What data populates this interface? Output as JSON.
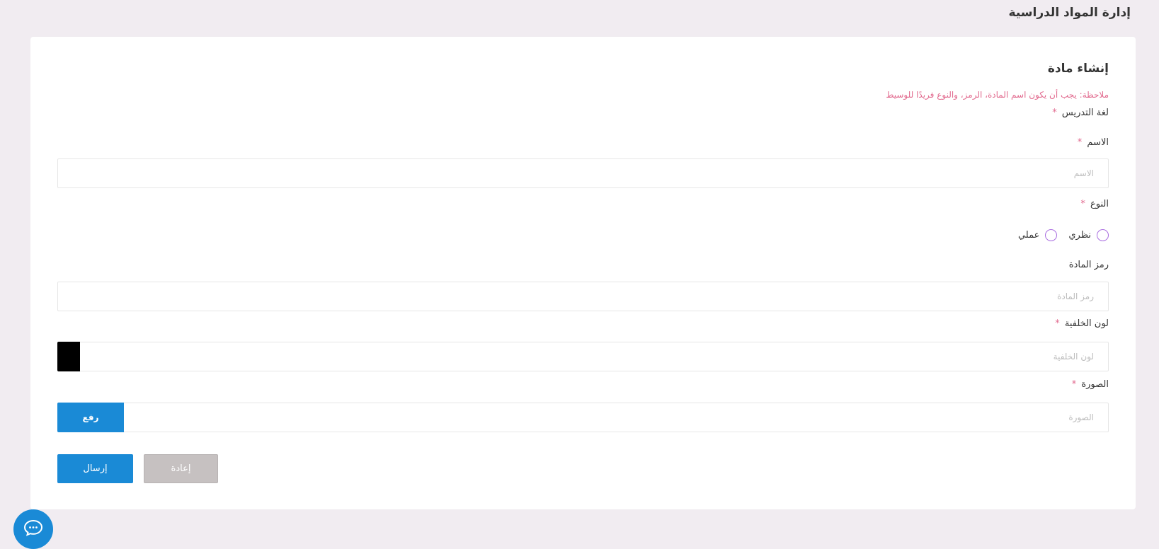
{
  "page": {
    "title": "إدارة المواد الدراسية"
  },
  "form": {
    "title": "إنشاء مادة",
    "note": "ملاحظة: يجب أن يكون اسم المادة، الرمز، والنوع فريدًا للوسيط",
    "required_mark": "*",
    "language": {
      "label": "لغة التدريس"
    },
    "name": {
      "label": "الاسم",
      "placeholder": "الاسم",
      "value": ""
    },
    "type": {
      "label": "النوع",
      "options": [
        "نظري",
        "عملي"
      ]
    },
    "code": {
      "label": "رمز المادة",
      "placeholder": "رمز المادة",
      "value": ""
    },
    "background_color": {
      "label": "لون الخلفية",
      "placeholder": "لون الخلفية",
      "value": "",
      "swatch_color": "#000000"
    },
    "image": {
      "label": "الصورة",
      "placeholder": "الصورة",
      "upload_label": "رفع"
    },
    "buttons": {
      "reset_label": "إعادة",
      "submit_label": "إرسال"
    }
  },
  "colors": {
    "primary": "#1a8ad6",
    "accent_required": "#e26b8f",
    "radio_border": "#a96de0",
    "page_bg": "#f1ecf1"
  },
  "icons": {
    "chat": "chat-bubble-icon"
  }
}
